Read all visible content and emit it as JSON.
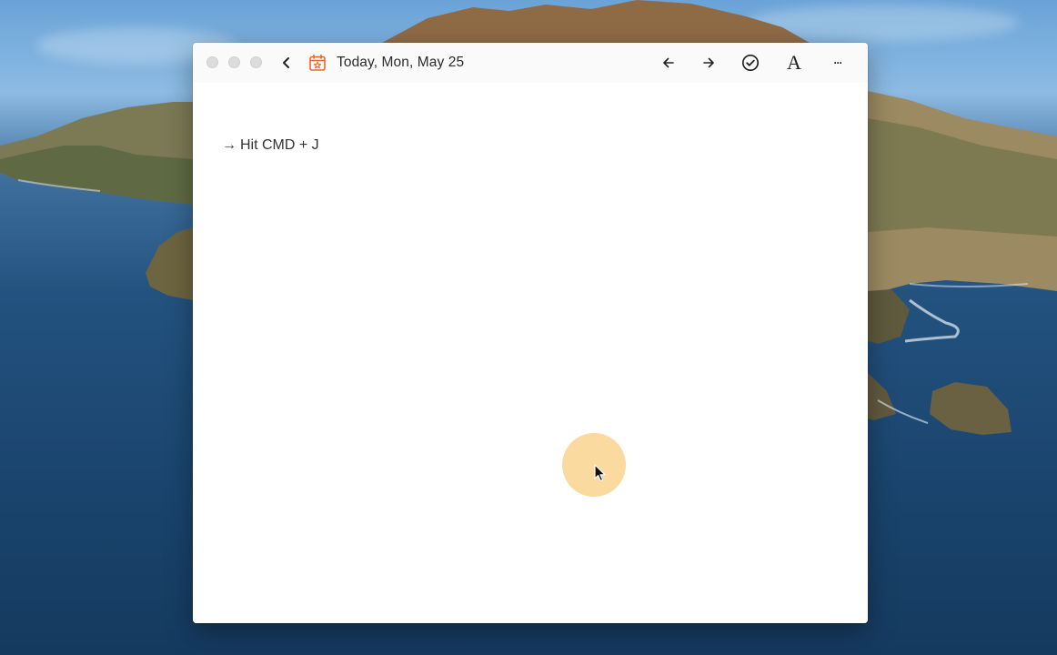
{
  "window": {
    "date_title": "Today, Mon, May 25",
    "accent_color": "#e46a2b"
  },
  "toolbar": {
    "icons": [
      "chevron-left-icon",
      "calendar-star-icon",
      "arrow-left-icon",
      "arrow-right-icon",
      "check-circle-icon",
      "font-a-icon",
      "more-icon"
    ],
    "font_label": "A",
    "more_label": "···"
  },
  "document": {
    "lines": [
      {
        "arrow": "→",
        "text": "Hit CMD + J"
      }
    ]
  },
  "overlay": {
    "click_indicator_color": "#f8cc78"
  }
}
